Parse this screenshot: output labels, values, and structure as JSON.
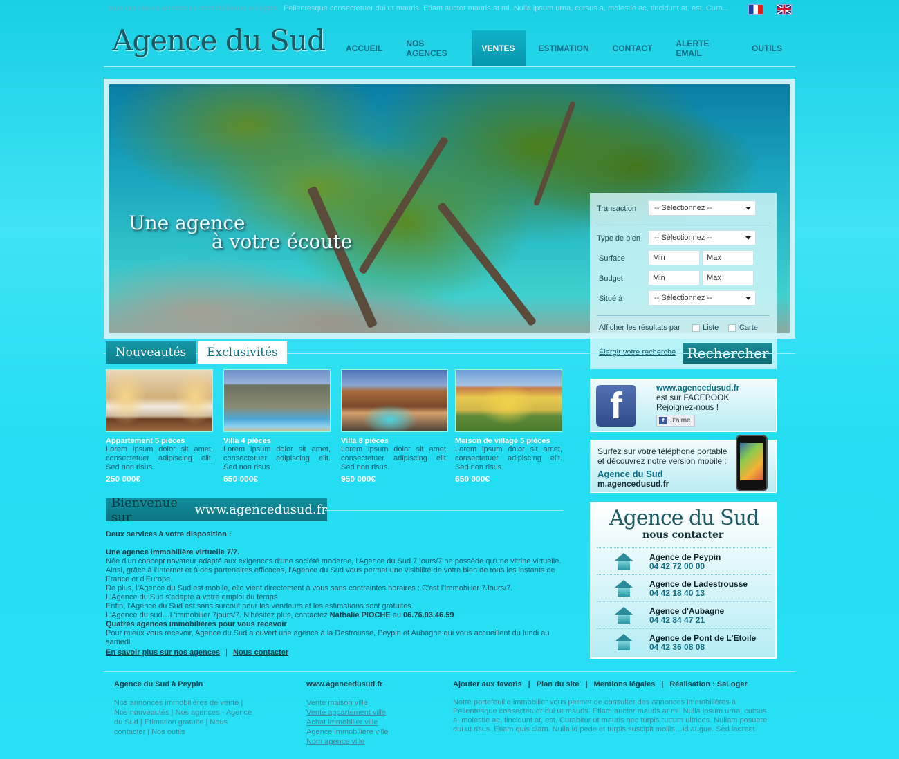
{
  "ticker": {
    "label": "Nos dernieres annonces immobilieres en ligne :",
    "message": "Pellentesque consectetuer dui ut mauris. Etiam auctor mauris at mi. Nulla ipsum urna, cursus a, molestie ac, tincidunt at, est. Cura..."
  },
  "languages": [
    {
      "icon": "flag-fr-icon",
      "label": "Français"
    },
    {
      "icon": "flag-en-icon",
      "label": "English"
    }
  ],
  "header": {
    "logo": "Agence du Sud",
    "nav": [
      "ACCUEIL",
      "NOS AGENCES",
      "VENTES",
      "ESTIMATION",
      "CONTACT",
      "ALERTE EMAIL",
      "OUTILS"
    ],
    "active_nav": "VENTES"
  },
  "hero": {
    "tagline_line1": "Une agence",
    "tagline_line2": "à votre écoute"
  },
  "search": {
    "transaction_label": "Transaction",
    "transaction_value": "-- Sélectionnez --",
    "type_label": "Type de bien",
    "type_value": "-- Sélectionnez --",
    "surface_label": "Surface",
    "surface_min": "Min",
    "surface_max": "Max",
    "budget_label": "Budget",
    "budget_min": "Min",
    "budget_max": "Max",
    "situe_label": "Situé à",
    "situe_value": "-- Sélectionnez --",
    "display_label": "Afficher les résultats par",
    "option_list": "Liste",
    "option_map": "Carte",
    "elargir": "Élargir votre recherche",
    "submit": "Rechercher"
  },
  "tabs": {
    "new": "Nouveautés",
    "exclusive": "Exclusivités"
  },
  "listings": [
    {
      "title": "Appartement 5 pièces",
      "desc": "Lorem ipsum dolor sit amet, consectetuer adipiscing elit. Sed non risus.",
      "price": "250 000€"
    },
    {
      "title": "Villa 4 pièces",
      "desc": "Lorem ipsum dolor sit amet, consectetuer adipiscing elit. Sed non risus.",
      "price": "650 000€"
    },
    {
      "title": "Villa 8 pièces",
      "desc": "Lorem ipsum dolor sit amet, consectetuer adipiscing elit. Sed non risus.",
      "price": "950 000€"
    },
    {
      "title": "Maison de village 5 pièces",
      "desc": "Lorem ipsum dolor sit amet, consectetuer adipiscing elit. Sed non risus.",
      "price": "650 000€"
    }
  ],
  "welcome": {
    "banner_prefix": "Bienvenue sur",
    "banner_site": "www.agencedusud.fr",
    "intro": "Deux services à votre disposition :",
    "h1": "Une agence immobilière virtuelle 7/7.",
    "p1": "Née d'un concept novateur adapté aux exigences d'une société moderne, l'Agence du Sud 7 jours/7 ne possède qu'une vitrine virtuelle.",
    "p2": "Ainsi, grâce à l'Internet et à des partenaires efficaces, l'Agence du Sud vous permet une visibilité de votre bien de tous les instants de France et d'Europe.",
    "p3": "De plus, l'Agence du Sud est mobile, elle vient directement à vous sans contraintes horaires : C'est l'Immobilier 7Jours/7.",
    "p4": "L'Agence du Sud s'adapte à votre emploi du temps",
    "p5": "Enfin, l'Agence du Sud est sans surcoût pour les vendeurs et les estimations sont gratuites.",
    "p6_a": "L'Agence du sud…L'immobilier 7jours/7. N'hésitez plus, contactez",
    "p6_name": "Nathalie PIOCHE",
    "p6_au": "au",
    "p6_tel": "06.76.03.46.59",
    "h2": "Quatres agences immobilières pour vous recevoir",
    "p7": "Pour mieux vous recevoir, Agence du Sud a ouvert une agence à la Destrousse, Peypin et Aubagne qui vous accueillent du lundi au samedi.",
    "link1": "En savoir plus sur nos agences",
    "link_sep": "|",
    "link2": "Nous contacter"
  },
  "facebook": {
    "site": "www.agencedusud.fr",
    "line2": "est sur FACEBOOK",
    "line3": "Rejoignez-nous !",
    "like": "J'aime"
  },
  "mobile": {
    "line1": "Surfez sur votre téléphone portable",
    "line2": "et découvrez notre version mobile :",
    "name": "Agence du Sud",
    "url": "m.agencedusud.fr"
  },
  "contact": {
    "logo": "Agence du Sud",
    "subtitle": "nous contacter",
    "agencies": [
      {
        "name": "Agence de Peypin",
        "tel": "04 42 72 00 00"
      },
      {
        "name": "Agence de Ladestrousse",
        "tel": "04 42 18 40 13"
      },
      {
        "name": "Agence d'Aubagne",
        "tel": "04 42 84 47 21"
      },
      {
        "name": "Agence de Pont de L'Etoile",
        "tel": "04 42 36 08 08"
      }
    ]
  },
  "footer": {
    "col1_title": "Agence du Sud à Peypin",
    "col1_text": "Nos annonces immobilières de vente | Nos nouveautés | Nos agences - Agence du Sud | Etimation gratuite | Nous contacter | Nos outils",
    "col2_title": "www.agencedusud.fr",
    "col2_links": [
      "Vente maison ville",
      "Vente appartement ville",
      "Achat immobilier ville",
      "Agence immobiliere ville",
      "Nom agence ville"
    ],
    "links": [
      "Ajouter aux favoris",
      "Plan du site",
      "Mentions légales",
      "Réalisation : SeLoger"
    ],
    "link_sep": "|",
    "col3_text": "Notre portefeuille immobilier vous permet de consulter des annonces immobilières à Pellentesque consectetuer dui ut mauris. Etiam auctor mauris at mi. Nulla ipsum urna, cursus a, molestie ac, tincidunt at, est. Curabitur ut mauris nec turpis rutrum ultrices. Nullam posuere dui ut risus. Etiam quis diam. Nulla id pede et turpis suscipit mollis…id augue. Sed laoreet."
  }
}
